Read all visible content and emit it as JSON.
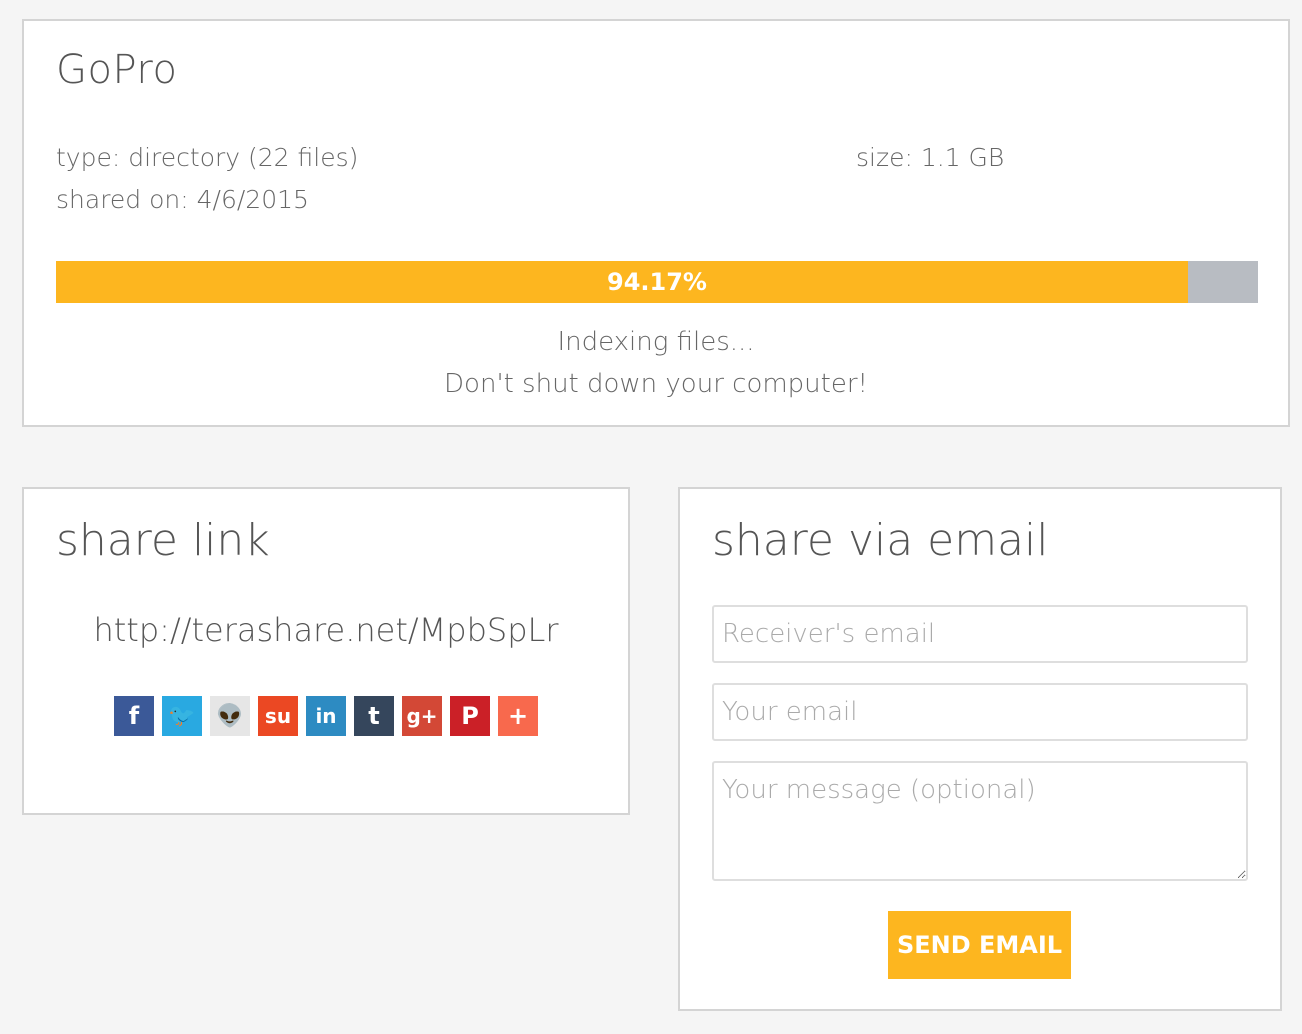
{
  "file": {
    "name": "GoPro",
    "type_line": "type: directory (22 files)",
    "shared_line": "shared on: 4/6/2015",
    "size_line": "size: 1.1 GB",
    "progress_percent": 94.17,
    "progress_label": "94.17%",
    "status_line_1": "Indexing files...",
    "status_line_2": "Don't shut down your computer!",
    "colors": {
      "progress_fill": "#fdb61f",
      "progress_track": "#b8bcc2"
    }
  },
  "share_link": {
    "heading": "share link",
    "url": "http://terashare.net/MpbSpLr",
    "social": [
      {
        "name": "facebook",
        "glyph": "f",
        "color": "#3b5998"
      },
      {
        "name": "twitter",
        "glyph": "🐦",
        "color": "#29a9e1"
      },
      {
        "name": "reddit",
        "glyph": "👽",
        "color": "#e6e6e6"
      },
      {
        "name": "stumbleupon",
        "glyph": "su",
        "color": "#eb4823"
      },
      {
        "name": "linkedin",
        "glyph": "in",
        "color": "#2d8bc2"
      },
      {
        "name": "tumblr",
        "glyph": "t",
        "color": "#35465c"
      },
      {
        "name": "google-plus",
        "glyph": "g+",
        "color": "#d34836"
      },
      {
        "name": "pinterest",
        "glyph": "P",
        "color": "#cb2027"
      },
      {
        "name": "more",
        "glyph": "+",
        "color": "#f8694d"
      }
    ]
  },
  "share_email": {
    "heading": "share via email",
    "receiver_placeholder": "Receiver's email",
    "your_email_placeholder": "Your email",
    "message_placeholder": "Your message (optional)",
    "send_label": "SEND EMAIL",
    "button_color": "#fdb61f"
  }
}
